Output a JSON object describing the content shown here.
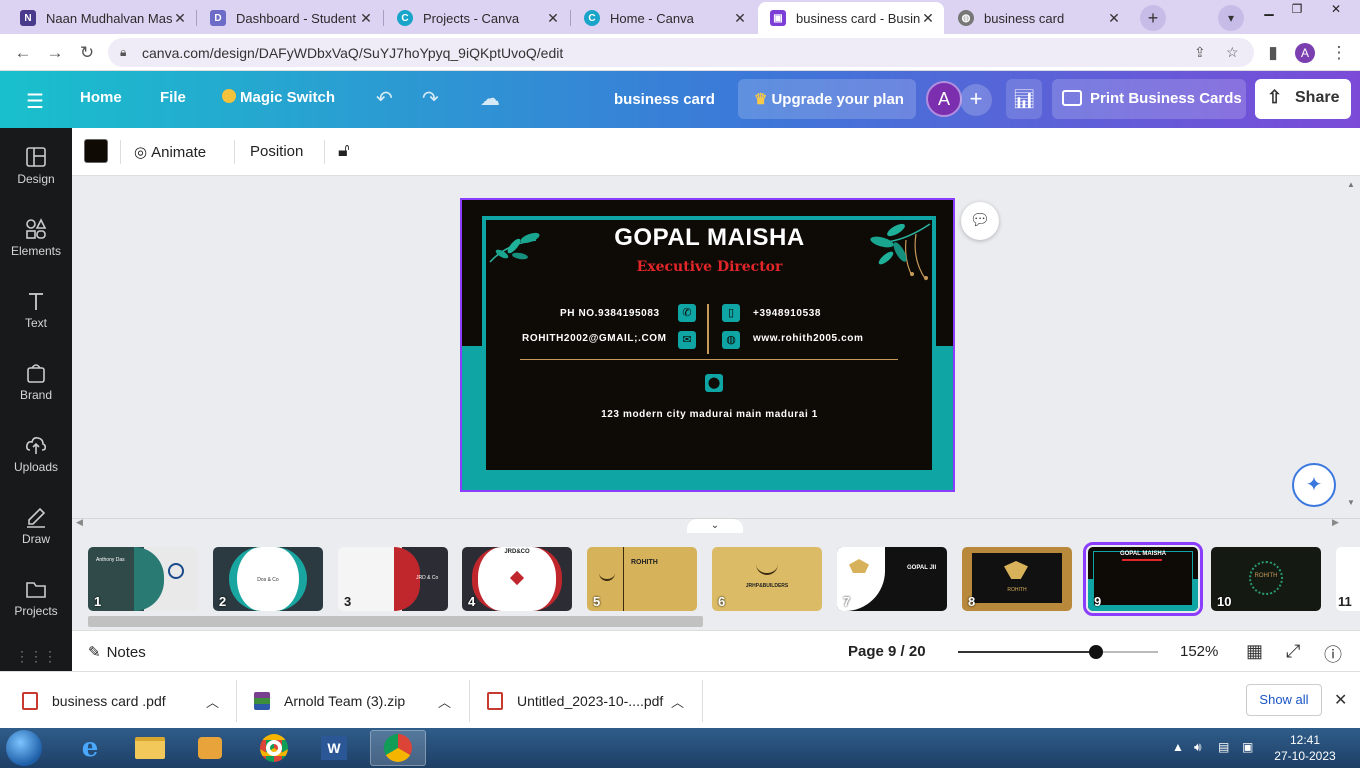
{
  "browser": {
    "tabs": [
      {
        "title": "Naan Mudhalvan Mass",
        "favicon_color": "#4a3a8c",
        "active": false
      },
      {
        "title": "Dashboard - Student",
        "favicon_color": "#6c6cc8",
        "active": false
      },
      {
        "title": "Projects - Canva",
        "favicon_color": "#19a5c9",
        "active": false
      },
      {
        "title": "Home - Canva",
        "favicon_color": "#19a5c9",
        "active": false
      },
      {
        "title": "business card - Busines",
        "favicon_color": "#7b3fd8",
        "active": true
      },
      {
        "title": "business card",
        "favicon_color": "#777777",
        "active": false
      }
    ],
    "url": "canva.com/design/DAFyWDbxVaQ/SuYJ7hoYpyq_9iQKptUvoQ/edit",
    "profile_initial": "A"
  },
  "canva_header": {
    "home": "Home",
    "file": "File",
    "magic_switch": "Magic Switch",
    "doc_title": "business card",
    "upgrade": "Upgrade your plan",
    "avatar_initial": "A",
    "print": "Print Business Cards",
    "share": "Share"
  },
  "sidebar": [
    {
      "label": "Design",
      "icon": "layout-icon"
    },
    {
      "label": "Elements",
      "icon": "shapes-icon"
    },
    {
      "label": "Text",
      "icon": "text-icon"
    },
    {
      "label": "Brand",
      "icon": "brand-icon"
    },
    {
      "label": "Uploads",
      "icon": "upload-icon"
    },
    {
      "label": "Draw",
      "icon": "draw-icon"
    },
    {
      "label": "Projects",
      "icon": "folder-icon"
    }
  ],
  "toolbar": {
    "color": "#0f0a04",
    "animate": "Animate",
    "position": "Position"
  },
  "card": {
    "name": "GOPAL MAISHA",
    "title": "Executive Director",
    "phone_left": "PH NO.9384195083",
    "email": "ROHITH2002@GMAIL;.COM",
    "phone_right": "+3948910538",
    "website": "www.rohith2005.com",
    "address": "123 modern city madurai main madurai 1",
    "accent_color": "#0ea5a4",
    "title_color": "#e3262a"
  },
  "thumbnails": [
    {
      "num": "1",
      "bg": "#e9e9e9",
      "accent": "#2a7a74"
    },
    {
      "num": "2",
      "bg": "#2b3a40",
      "accent": "#19a5a0"
    },
    {
      "num": "3",
      "bg": "#f5f5f5",
      "accent": "#c0272d"
    },
    {
      "num": "4",
      "bg": "#2c2c34",
      "accent": "#c0272d"
    },
    {
      "num": "5",
      "bg": "#d6b25a",
      "accent": "#3a2a10"
    },
    {
      "num": "6",
      "bg": "#dcbb66",
      "accent": "#3a2a10"
    },
    {
      "num": "7",
      "bg": "#111111",
      "accent": "#d8b25a"
    },
    {
      "num": "8",
      "bg": "#b8893a",
      "accent": "#111111"
    },
    {
      "num": "9",
      "bg": "#0e0a05",
      "accent": "#0ea5a4"
    },
    {
      "num": "10",
      "bg": "#141a12",
      "accent": "#2a9a72"
    },
    {
      "num": "11",
      "bg": "#ffffff",
      "accent": "#1a4a8a"
    }
  ],
  "thumb_text": {
    "t1_name": "Anthony Das",
    "t2_name": "Dos & Co",
    "t3_name": "JRD & Co",
    "t4_name": "JRD&CO",
    "t5_name": "ROHITH",
    "t6_name": "JRHP&BUILDERS",
    "t7_name": "GOPAL JII",
    "t8_name": "ROHITH",
    "t9_name": "GOPAL MAISHA",
    "t10_name": "ROHITH"
  },
  "footer": {
    "notes": "Notes",
    "page_indicator": "Page 9 / 20",
    "zoom": "152%",
    "zoom_fraction": 0.69
  },
  "downloads": [
    {
      "name": "business card .pdf",
      "icon_color": "#c73a2f"
    },
    {
      "name": "Arnold Team (3).zip",
      "icon_color": "#7a3e8e"
    },
    {
      "name": "Untitled_2023-10-....pdf",
      "icon_color": "#c73a2f"
    }
  ],
  "downloads_show_all": "Show all",
  "taskbar": {
    "time": "12:41",
    "date": "27-10-2023"
  }
}
